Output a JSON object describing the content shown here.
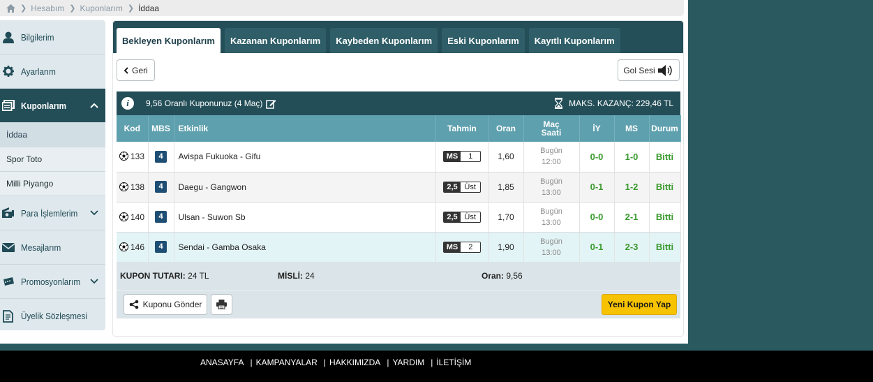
{
  "breadcrumb": {
    "items": [
      "Hesabım",
      "Kuponlarım"
    ],
    "current": "İddaa"
  },
  "sidebar": {
    "items": [
      {
        "label": "Bilgilerim",
        "icon": "user-icon"
      },
      {
        "label": "Ayarlarım",
        "icon": "gear-icon"
      },
      {
        "label": "Kuponlarım",
        "icon": "coupon-icon",
        "active": true
      },
      {
        "label": "Para İşlemlerim",
        "icon": "cash-icon"
      },
      {
        "label": "Mesajlarım",
        "icon": "envelope-icon"
      },
      {
        "label": "Promosyonlarım",
        "icon": "ticket-icon"
      },
      {
        "label": "Üyelik Sözleşmesi",
        "icon": "document-icon"
      }
    ],
    "subitems": [
      "İddaa",
      "Spor Toto",
      "Milli Piyango"
    ]
  },
  "tabs": [
    "Bekleyen Kuponlarım",
    "Kazanan Kuponlarım",
    "Kaybeden Kuponlarım",
    "Eski Kuponlarım",
    "Kayıtlı Kuponlarım"
  ],
  "buttons": {
    "back": "Geri",
    "goal_sound": "Gol Sesi",
    "send": "Kuponu Gönder",
    "new_coupon": "Yeni Kupon Yap"
  },
  "coupon": {
    "title": "9,56 Oranlı Kuponunuz (4 Maç)",
    "max_win": "MAKS. KAZANÇ: 229,46 TL"
  },
  "table": {
    "headers": {
      "kod": "Kod",
      "mbs": "MBS",
      "etkinlik": "Etkinlik",
      "tahmin": "Tahmin",
      "oran": "Oran",
      "mac_saati_1": "Maç",
      "mac_saati_2": "Saati",
      "iy": "İY",
      "ms": "MS",
      "durum": "Durum"
    },
    "rows": [
      {
        "kod": "133",
        "mbs": "4",
        "event": "Avispa Fukuoka - Gifu",
        "pick_a": "MS",
        "pick_b": "1",
        "odd": "1,60",
        "day": "Bugün",
        "time": "12:00",
        "iy": "0-0",
        "ms": "1-0",
        "status": "Bitti"
      },
      {
        "kod": "138",
        "mbs": "4",
        "event": "Daegu - Gangwon",
        "pick_a": "2,5",
        "pick_b": "Üst",
        "odd": "1,85",
        "day": "Bugün",
        "time": "13:00",
        "iy": "0-1",
        "ms": "1-2",
        "status": "Bitti"
      },
      {
        "kod": "140",
        "mbs": "4",
        "event": "Ulsan - Suwon Sb",
        "pick_a": "2,5",
        "pick_b": "Üst",
        "odd": "1,70",
        "day": "Bugün",
        "time": "13:00",
        "iy": "0-0",
        "ms": "2-1",
        "status": "Bitti"
      },
      {
        "kod": "146",
        "mbs": "4",
        "event": "Sendai - Gamba Osaka",
        "pick_a": "MS",
        "pick_b": "2",
        "odd": "1,90",
        "day": "Bugün",
        "time": "13:00",
        "iy": "0-1",
        "ms": "2-3",
        "status": "Bitti"
      }
    ]
  },
  "summary": {
    "amount_label": "KUPON TUTARI:",
    "amount": "24 TL",
    "misli_label": "MİSLİ:",
    "misli": "24",
    "odds_label": "Oran:",
    "odds": "9,56"
  },
  "footer": {
    "links": [
      "ANASAYFA",
      "KAMPANYALAR",
      "HAKKIMIZDA",
      "YARDIM",
      "İLETİŞİM"
    ],
    "separator": "|"
  },
  "colors": {
    "primary": "#234e58",
    "header_cell": "#5fa0ae",
    "win_green": "#3a9a2e",
    "cta_yellow": "#f7c300",
    "page_bg": "#2a5a60"
  }
}
